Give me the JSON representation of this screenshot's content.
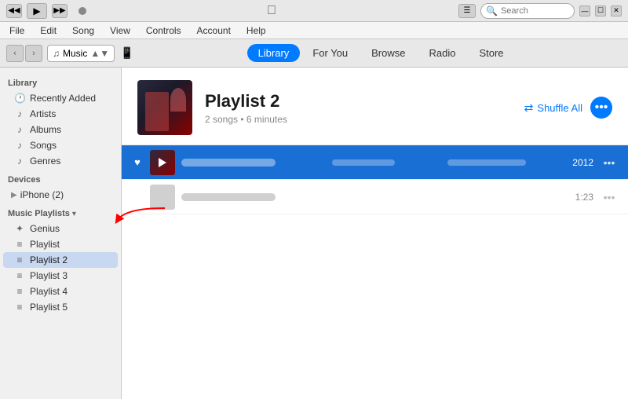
{
  "titlebar": {
    "transport": {
      "back_label": "◀◀",
      "play_label": "▶",
      "forward_label": "▶▶"
    },
    "apple_logo": "",
    "search_placeholder": "Search",
    "win_buttons": [
      "—",
      "☐",
      "✕"
    ]
  },
  "menubar": {
    "items": [
      "File",
      "Edit",
      "Song",
      "View",
      "Controls",
      "Account",
      "Help"
    ]
  },
  "navbar": {
    "back_arrow": "‹",
    "forward_arrow": "›",
    "music_label": "Music",
    "tabs": [
      "Library",
      "For You",
      "Browse",
      "Radio",
      "Store"
    ],
    "active_tab": "Library"
  },
  "sidebar": {
    "library_header": "Library",
    "library_items": [
      {
        "icon": "🕐",
        "label": "Recently Added"
      },
      {
        "icon": "♪",
        "label": "Artists"
      },
      {
        "icon": "♪",
        "label": "Albums"
      },
      {
        "icon": "♪",
        "label": "Songs"
      },
      {
        "icon": "♪",
        "label": "Genres"
      }
    ],
    "devices_header": "Devices",
    "device_label": "iPhone (2)",
    "playlists_header": "Music Playlists",
    "playlist_items": [
      {
        "icon": "✦",
        "label": "Genius"
      },
      {
        "icon": "≡",
        "label": "Playlist"
      },
      {
        "icon": "≡",
        "label": "Playlist 2",
        "active": true
      },
      {
        "icon": "≡",
        "label": "Playlist 3"
      },
      {
        "icon": "≡",
        "label": "Playlist 4"
      },
      {
        "icon": "≡",
        "label": "Playlist 5"
      }
    ]
  },
  "content": {
    "playlist_title": "Playlist 2",
    "playlist_meta": "2 songs • 6 minutes",
    "shuffle_label": "Shuffle All",
    "tracks": [
      {
        "playing": true,
        "loved": true,
        "name_blurred": true,
        "artist_blurred": true,
        "album_blurred": true,
        "year": "2012",
        "duration": ""
      },
      {
        "playing": false,
        "loved": false,
        "name_blurred": true,
        "artist_blurred": false,
        "album_blurred": false,
        "year": "",
        "duration": "1:23"
      }
    ]
  }
}
